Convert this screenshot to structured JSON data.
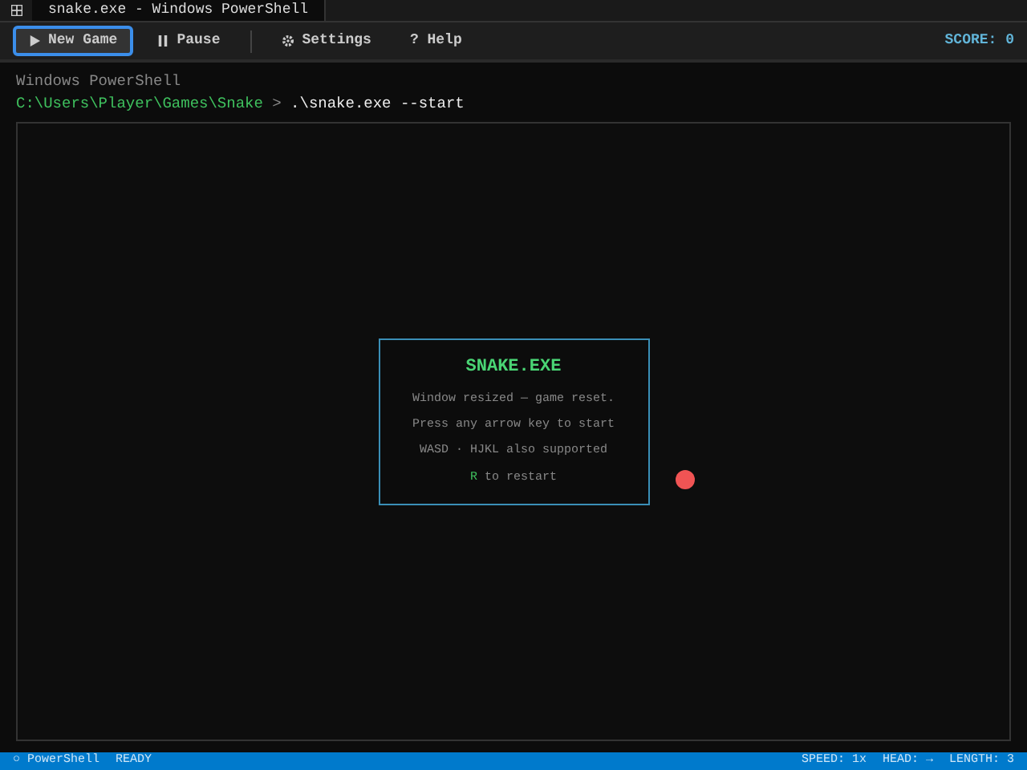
{
  "window": {
    "tab_title": "snake.exe - Windows PowerShell"
  },
  "toolbar": {
    "buttons": [
      {
        "kind": "play",
        "label": "New Game",
        "selected": true
      },
      {
        "kind": "pause",
        "label": "Pause",
        "selected": false
      },
      {
        "kind": "gear",
        "label": "Settings",
        "selected": false
      },
      {
        "kind": "plain",
        "label": "? Help",
        "selected": false
      }
    ],
    "score": "SCORE: 0"
  },
  "terminal": {
    "banner": "Windows PowerShell",
    "prompt_path": "C:\\Users\\Player\\Games\\Snake",
    "prompt_sign": ">",
    "command": ".\\snake.exe --start"
  },
  "game": {
    "dialog": {
      "title": "SNAKE.EXE",
      "lines": [
        {
          "text": "Window resized — game reset."
        },
        {
          "text": "Press any arrow key to start"
        },
        {
          "text": "WASD · HJKL also supported"
        },
        {
          "key": "R",
          "text": "to restart"
        }
      ]
    }
  },
  "status_bar": {
    "left": [
      "○ PowerShell",
      "READY"
    ],
    "right": [
      "SPEED: 1x",
      "HEAD: →",
      "LENGTH: 3"
    ]
  }
}
